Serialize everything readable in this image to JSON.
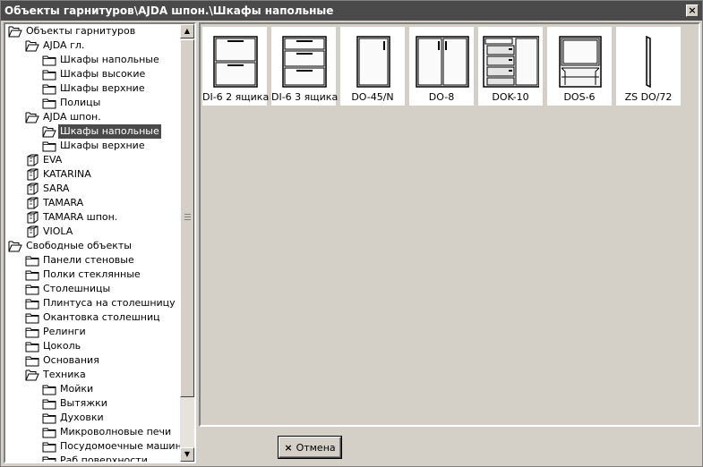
{
  "window": {
    "title": "Объекты гарнитуров\\AJDA шпон.\\Шкафы напольные",
    "close_symbol": "×"
  },
  "tree": [
    {
      "label": "Объекты гарнитуров",
      "level": 0,
      "icon": "open-folder-icon",
      "selected": false
    },
    {
      "label": "AJDA гл.",
      "level": 1,
      "icon": "open-folder-icon",
      "selected": false
    },
    {
      "label": "Шкафы напольные",
      "level": 2,
      "icon": "folder-icon",
      "selected": false
    },
    {
      "label": "Шкафы высокие",
      "level": 2,
      "icon": "folder-icon",
      "selected": false
    },
    {
      "label": "Шкафы верхние",
      "level": 2,
      "icon": "folder-icon",
      "selected": false
    },
    {
      "label": "Полицы",
      "level": 2,
      "icon": "folder-icon",
      "selected": false
    },
    {
      "label": "AJDA шпон.",
      "level": 1,
      "icon": "open-folder-icon",
      "selected": false
    },
    {
      "label": "Шкафы напольные",
      "level": 2,
      "icon": "open-folder-icon",
      "selected": true
    },
    {
      "label": "Шкафы верхние",
      "level": 2,
      "icon": "folder-icon",
      "selected": false
    },
    {
      "label": "EVA",
      "level": 1,
      "icon": "cabinet-icon",
      "selected": false
    },
    {
      "label": "KATARINA",
      "level": 1,
      "icon": "cabinet-icon",
      "selected": false
    },
    {
      "label": "SARA",
      "level": 1,
      "icon": "cabinet-icon",
      "selected": false
    },
    {
      "label": "TAMARA",
      "level": 1,
      "icon": "cabinet-icon",
      "selected": false
    },
    {
      "label": "TAMARA шпон.",
      "level": 1,
      "icon": "cabinet-icon",
      "selected": false
    },
    {
      "label": "VIOLA",
      "level": 1,
      "icon": "cabinet-icon",
      "selected": false
    },
    {
      "label": "Свободные объекты",
      "level": 0,
      "icon": "open-folder-icon",
      "selected": false
    },
    {
      "label": "Панели стеновые",
      "level": 1,
      "icon": "folder-icon",
      "selected": false
    },
    {
      "label": "Полки стеклянные",
      "level": 1,
      "icon": "folder-icon",
      "selected": false
    },
    {
      "label": "Столешницы",
      "level": 1,
      "icon": "folder-icon",
      "selected": false
    },
    {
      "label": "Плинтуса на столешницу",
      "level": 1,
      "icon": "folder-icon",
      "selected": false
    },
    {
      "label": "Окантовка столешниц",
      "level": 1,
      "icon": "folder-icon",
      "selected": false
    },
    {
      "label": "Релинги",
      "level": 1,
      "icon": "folder-icon",
      "selected": false
    },
    {
      "label": "Цоколь",
      "level": 1,
      "icon": "folder-icon",
      "selected": false
    },
    {
      "label": "Основания",
      "level": 1,
      "icon": "folder-icon",
      "selected": false
    },
    {
      "label": "Техника",
      "level": 1,
      "icon": "open-folder-icon",
      "selected": false
    },
    {
      "label": "Мойки",
      "level": 2,
      "icon": "folder-icon",
      "selected": false
    },
    {
      "label": "Вытяжки",
      "level": 2,
      "icon": "folder-icon",
      "selected": false
    },
    {
      "label": "Духовки",
      "level": 2,
      "icon": "folder-icon",
      "selected": false
    },
    {
      "label": "Микроволновые печи",
      "level": 2,
      "icon": "folder-icon",
      "selected": false
    },
    {
      "label": "Посудомоечные машины",
      "level": 2,
      "icon": "folder-icon",
      "selected": false
    },
    {
      "label": "Раб.поверхности",
      "level": 2,
      "icon": "folder-icon",
      "selected": false
    }
  ],
  "items": [
    {
      "label": "DI-6 2 ящика",
      "thumb": "two-drawer-cabinet-icon"
    },
    {
      "label": "DI-6 3 ящика",
      "thumb": "three-drawer-cabinet-icon"
    },
    {
      "label": "DO-45/N",
      "thumb": "single-door-cabinet-icon"
    },
    {
      "label": "DO-8",
      "thumb": "double-door-cabinet-icon"
    },
    {
      "label": "DOK-10",
      "thumb": "drawer-door-cabinet-icon"
    },
    {
      "label": "DOS-6",
      "thumb": "open-shelf-cabinet-icon"
    },
    {
      "label": "ZS DO/72",
      "thumb": "side-panel-icon"
    }
  ],
  "footer": {
    "cancel_label": "Отмена",
    "cancel_icon": "×"
  }
}
